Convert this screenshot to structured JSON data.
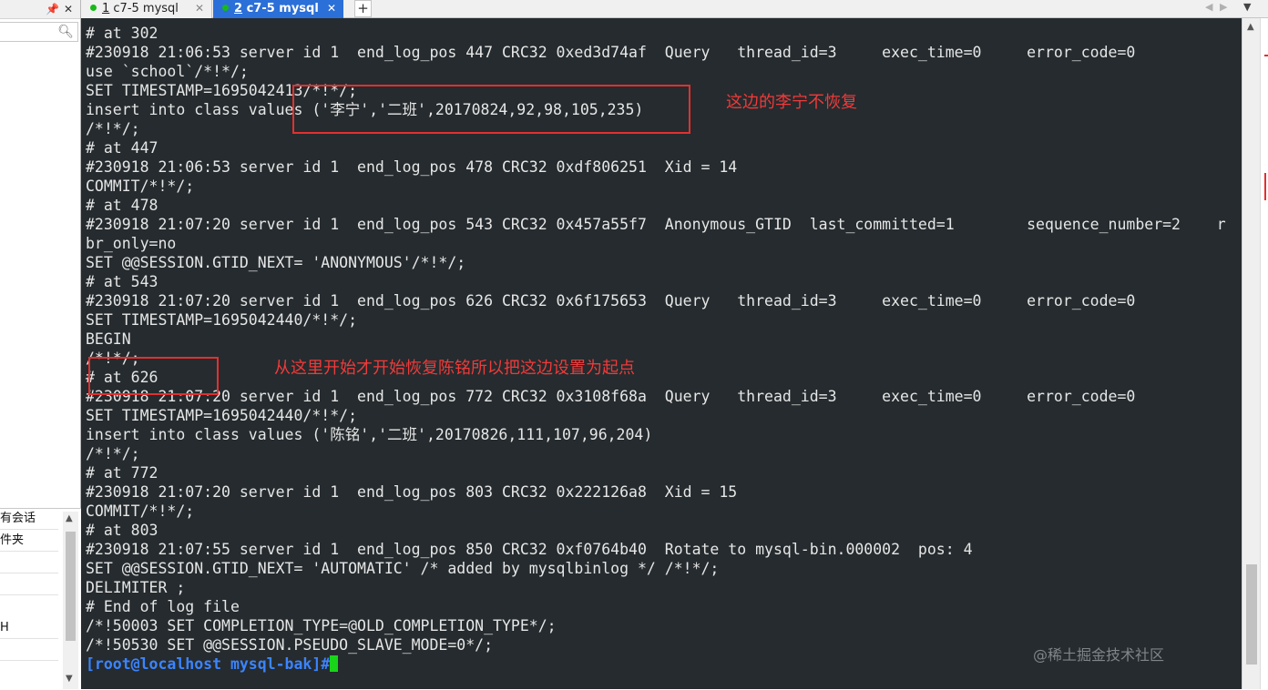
{
  "left_pane": {
    "pin_icon": "pin-icon",
    "close_icon": "close-icon",
    "search_icon": "search-icon",
    "session_items": [
      "有会话",
      "件夹",
      "",
      "",
      "H",
      ""
    ]
  },
  "tabs": [
    {
      "number": "1",
      "label": " c7-5 mysql",
      "active": false
    },
    {
      "number": "2",
      "label": " c7-5 mysql",
      "active": true
    }
  ],
  "tab_close_glyph": "✕",
  "new_tab_glyph": "+",
  "terminal": {
    "lines": [
      "# at 302",
      "#230918 21:06:53 server id 1  end_log_pos 447 CRC32 0xed3d74af  Query   thread_id=3     exec_time=0     error_code=0",
      "use `school`/*!*/;",
      "SET TIMESTAMP=1695042413/*!*/;",
      "insert into class values ('李宁','二班',20170824,92,98,105,235)",
      "/*!*/;",
      "# at 447",
      "#230918 21:06:53 server id 1  end_log_pos 478 CRC32 0xdf806251  Xid = 14",
      "COMMIT/*!*/;",
      "# at 478",
      "#230918 21:07:20 server id 1  end_log_pos 543 CRC32 0x457a55f7  Anonymous_GTID  last_committed=1        sequence_number=2    r",
      "br_only=no",
      "SET @@SESSION.GTID_NEXT= 'ANONYMOUS'/*!*/;",
      "# at 543",
      "#230918 21:07:20 server id 1  end_log_pos 626 CRC32 0x6f175653  Query   thread_id=3     exec_time=0     error_code=0",
      "SET TIMESTAMP=1695042440/*!*/;",
      "BEGIN",
      "/*!*/;",
      "# at 626",
      "#230918 21:07:20 server id 1  end_log_pos 772 CRC32 0x3108f68a  Query   thread_id=3     exec_time=0     error_code=0",
      "SET TIMESTAMP=1695042440/*!*/;",
      "insert into class values ('陈铭','二班',20170826,111,107,96,204)",
      "/*!*/;",
      "# at 772",
      "#230918 21:07:20 server id 1  end_log_pos 803 CRC32 0x222126a8  Xid = 15",
      "COMMIT/*!*/;",
      "# at 803",
      "#230918 21:07:55 server id 1  end_log_pos 850 CRC32 0xf0764b40  Rotate to mysql-bin.000002  pos: 4",
      "SET @@SESSION.GTID_NEXT= 'AUTOMATIC' /* added by mysqlbinlog */ /*!*/;",
      "DELIMITER ;",
      "# End of log file",
      "/*!50003 SET COMPLETION_TYPE=@OLD_COMPLETION_TYPE*/;",
      "/*!50530 SET @@SESSION.PSEUDO_SLAVE_MODE=0*/;"
    ],
    "prompt": "[root@localhost mysql-bak]#"
  },
  "annotations": {
    "lining_note": "这边的李宁不恢复",
    "chenming_note": "从这里开始才开始恢复陈铭所以把这边设置为起点"
  },
  "watermark": "@稀土掘金技术社区",
  "colors": {
    "terminal_bg": "#252b2e",
    "terminal_fg": "#e6e6e6",
    "prompt": "#3b84ff",
    "cursor": "#19d419",
    "annotation_red": "#f03a3a",
    "active_tab": "#2b6fd8",
    "tab_dot": "#18b818"
  }
}
